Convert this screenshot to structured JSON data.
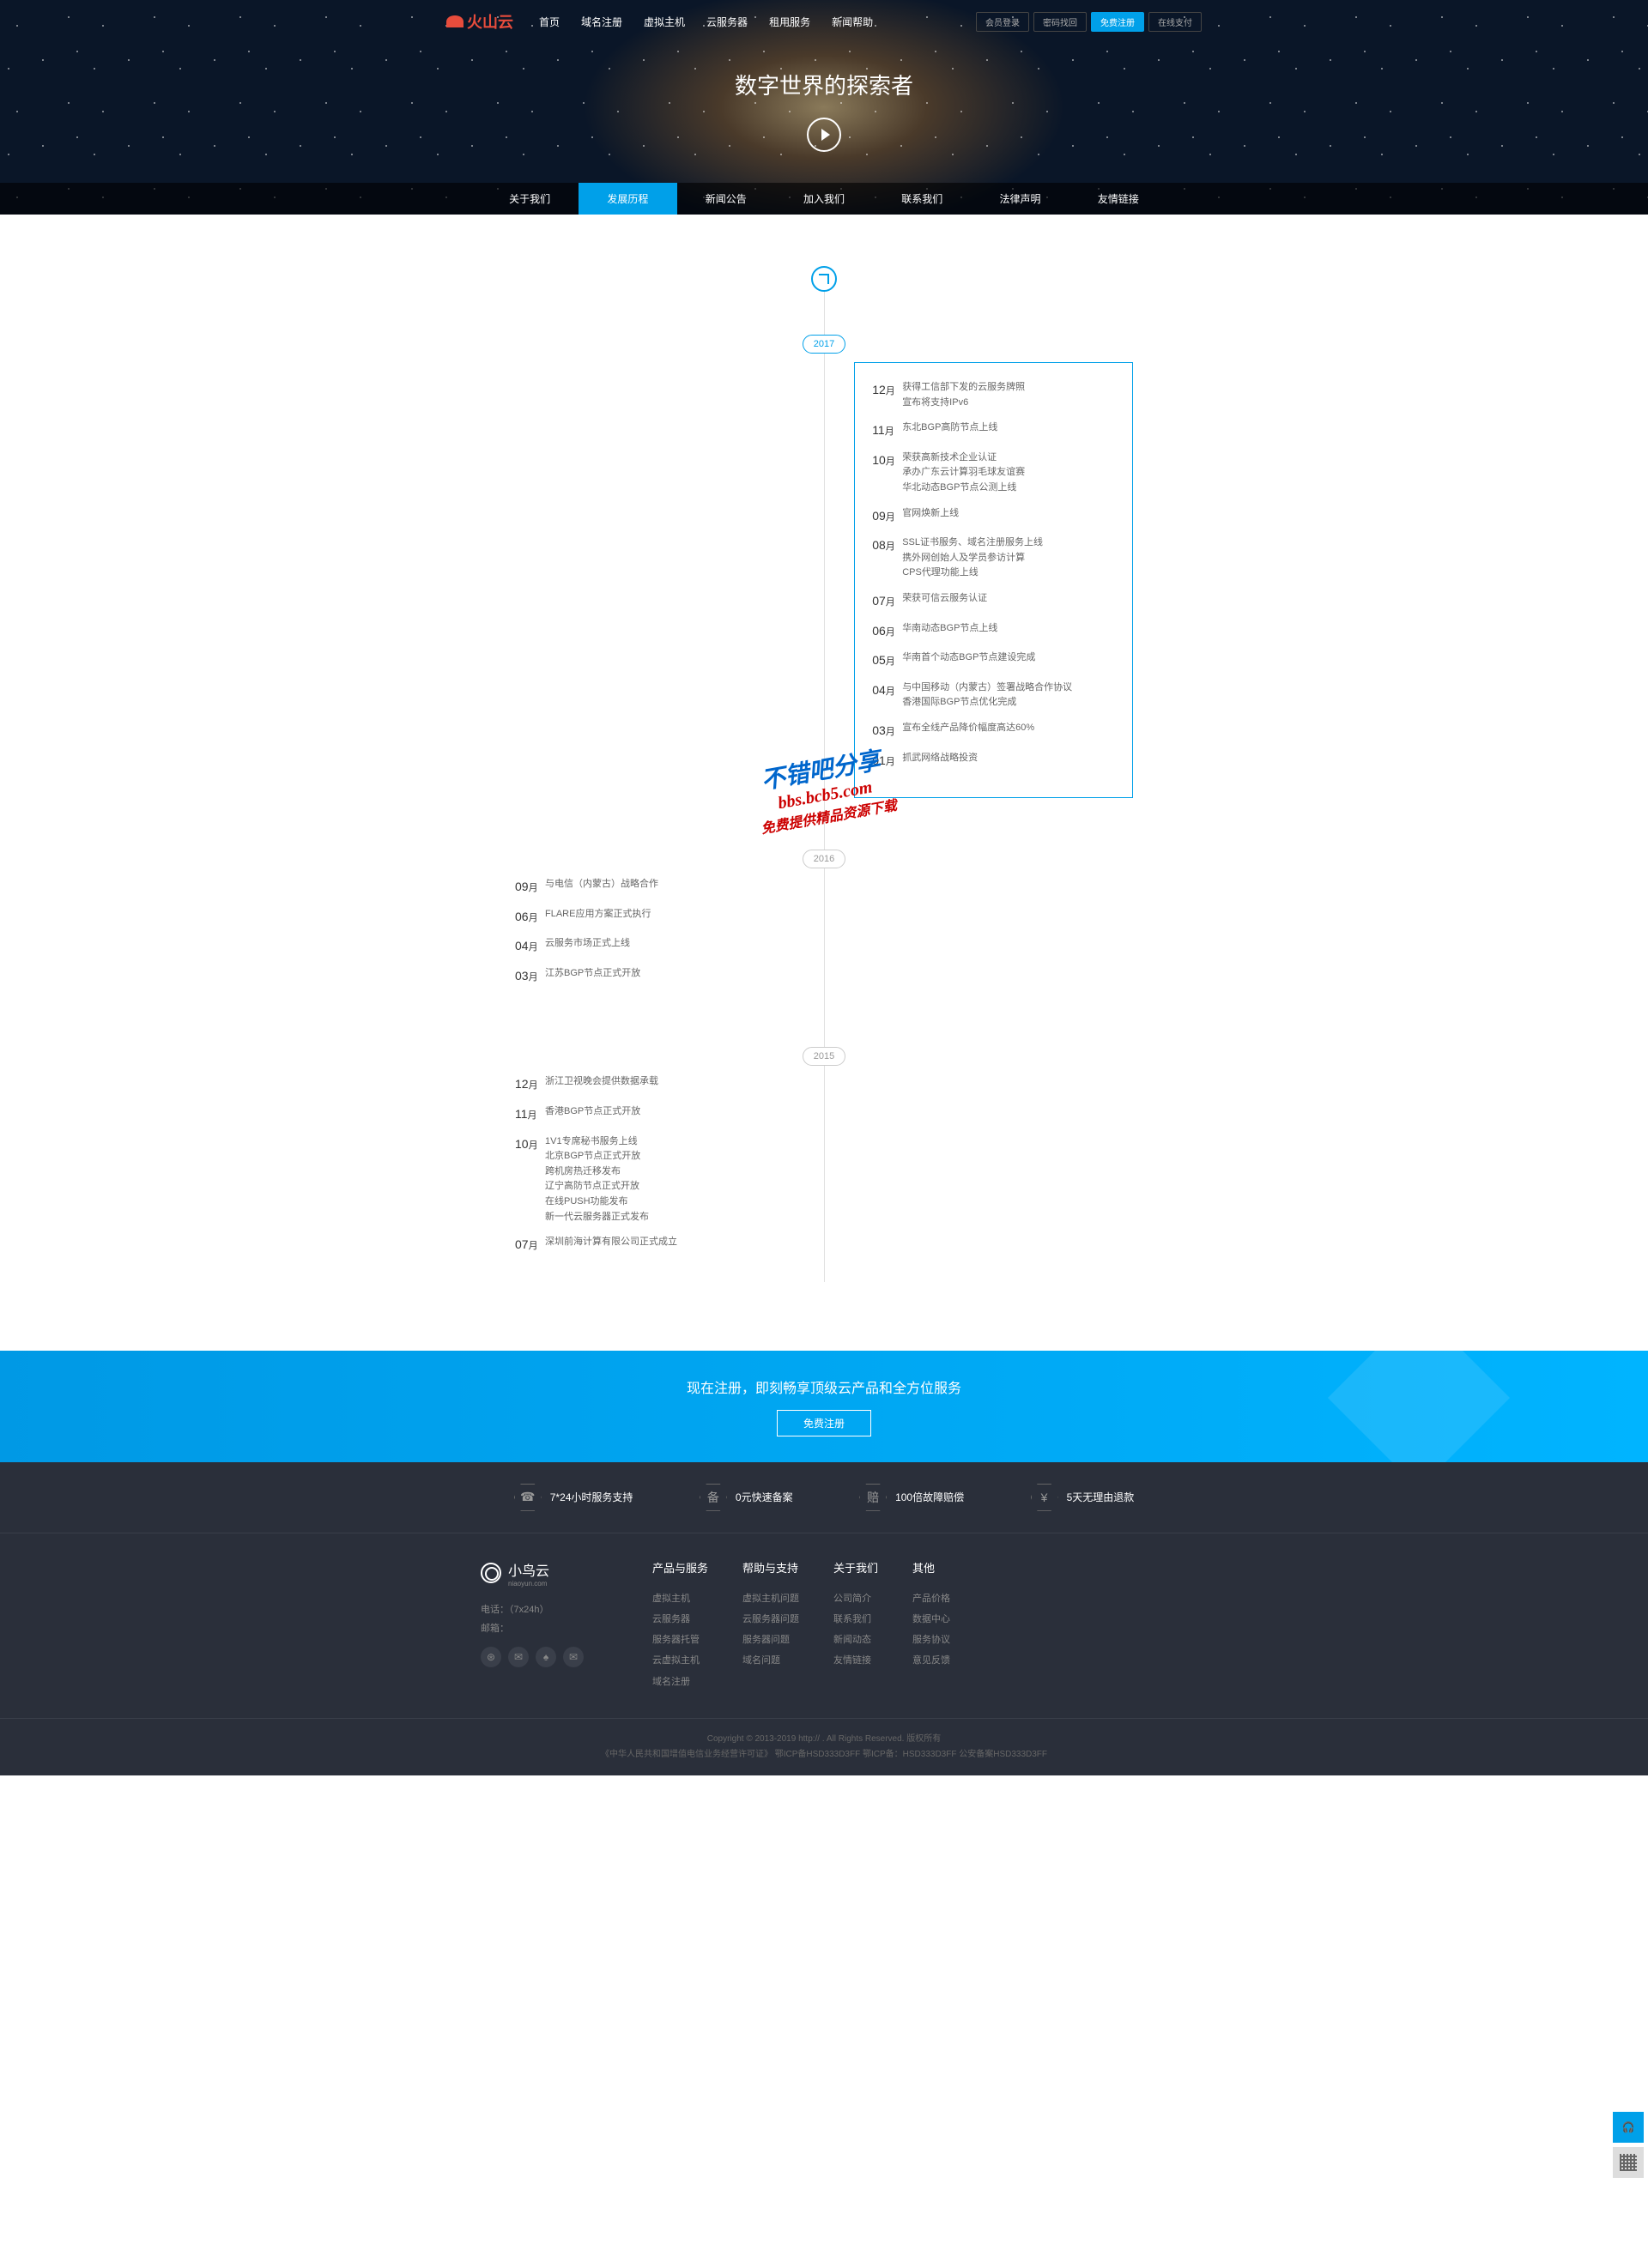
{
  "logo": "火山云",
  "nav": {
    "items": [
      "首页",
      "域名注册",
      "虚拟主机",
      "云服务器",
      "租用服务",
      "新闻帮助"
    ],
    "buttons": [
      "会员登录",
      "密码找回",
      "免费注册",
      "在线支付"
    ]
  },
  "hero": {
    "title": "数字世界的探索者"
  },
  "subnav": {
    "items": [
      "关于我们",
      "发展历程",
      "新闻公告",
      "加入我们",
      "联系我们",
      "法律声明",
      "友情链接"
    ],
    "active": 1
  },
  "watermark": {
    "line1": "不错吧分享",
    "line2": "bbs.bcb5.com",
    "line3": "免费提供精品资源下载"
  },
  "timeline": {
    "years": [
      {
        "year": "2017",
        "side": "right",
        "boxed": true,
        "events": [
          {
            "month": "12",
            "text": "获得工信部下发的云服务牌照\n宣布将支持IPv6"
          },
          {
            "month": "11",
            "text": "东北BGP高防节点上线"
          },
          {
            "month": "10",
            "text": "荣获高新技术企业认证\n承办广东云计算羽毛球友谊赛\n华北动态BGP节点公测上线"
          },
          {
            "month": "09",
            "text": "官网焕新上线"
          },
          {
            "month": "08",
            "text": "SSL证书服务、域名注册服务上线\n携外网创始人及学员参访计算\nCPS代理功能上线"
          },
          {
            "month": "07",
            "text": "荣获可信云服务认证"
          },
          {
            "month": "06",
            "text": "华南动态BGP节点上线"
          },
          {
            "month": "05",
            "text": "华南首个动态BGP节点建设完成"
          },
          {
            "month": "04",
            "text": "与中国移动（内蒙古）签署战略合作协议\n香港国际BGP节点优化完成"
          },
          {
            "month": "03",
            "text": "宣布全线产品降价幅度高达60%"
          },
          {
            "month": "01",
            "text": "抓武网络战略投资"
          }
        ]
      },
      {
        "year": "2016",
        "side": "left",
        "boxed": false,
        "events": [
          {
            "month": "09",
            "text": "与电信（内蒙古）战略合作"
          },
          {
            "month": "06",
            "text": "FLARE应用方案正式执行"
          },
          {
            "month": "04",
            "text": "云服务市场正式上线"
          },
          {
            "month": "03",
            "text": "江苏BGP节点正式开放"
          }
        ]
      },
      {
        "year": "2015",
        "side": "left",
        "boxed": false,
        "events": [
          {
            "month": "12",
            "text": "浙江卫视晚会提供数据承载"
          },
          {
            "month": "11",
            "text": "香港BGP节点正式开放"
          },
          {
            "month": "10",
            "text": "1V1专席秘书服务上线\n北京BGP节点正式开放\n跨机房热迁移发布\n辽宁高防节点正式开放\n在线PUSH功能发布\n新一代云服务器正式发布"
          },
          {
            "month": "07",
            "text": "深圳前海计算有限公司正式成立"
          }
        ]
      }
    ]
  },
  "cta": {
    "title": "现在注册，即刻畅享顶级云产品和全方位服务",
    "button": "免费注册"
  },
  "features": [
    {
      "icon": "☎",
      "text": "7*24小时服务支持"
    },
    {
      "icon": "备",
      "text": "0元快速备案"
    },
    {
      "icon": "赔",
      "text": "100倍故障赔偿"
    },
    {
      "icon": "¥",
      "text": "5天无理由退款"
    }
  ],
  "footer": {
    "logo": "小鸟云",
    "logo_sub": "niaoyun.com",
    "tel_label": "电话：",
    "tel": "（7x24h）",
    "email_label": "邮箱：",
    "cols": [
      {
        "title": "产品与服务",
        "links": [
          "虚拟主机",
          "云服务器",
          "服务器托管",
          "云虚拟主机",
          "域名注册"
        ]
      },
      {
        "title": "帮助与支持",
        "links": [
          "虚拟主机问题",
          "云服务器问题",
          "服务器问题",
          "域名问题"
        ]
      },
      {
        "title": "关于我们",
        "links": [
          "公司简介",
          "联系我们",
          "新闻动态",
          "友情链接"
        ]
      },
      {
        "title": "其他",
        "links": [
          "产品价格",
          "数据中心",
          "服务协议",
          "意见反馈"
        ]
      }
    ]
  },
  "copyright": {
    "line1": "Copyright © 2013-2019    http://    . All Rights Reserved. 版权所有",
    "line2": "《中华人民共和国增值电信业务经营许可证》 鄂ICP备HSD333D3FF     鄂ICP备：HSD333D3FF 公安备案HSD333D3FF"
  }
}
